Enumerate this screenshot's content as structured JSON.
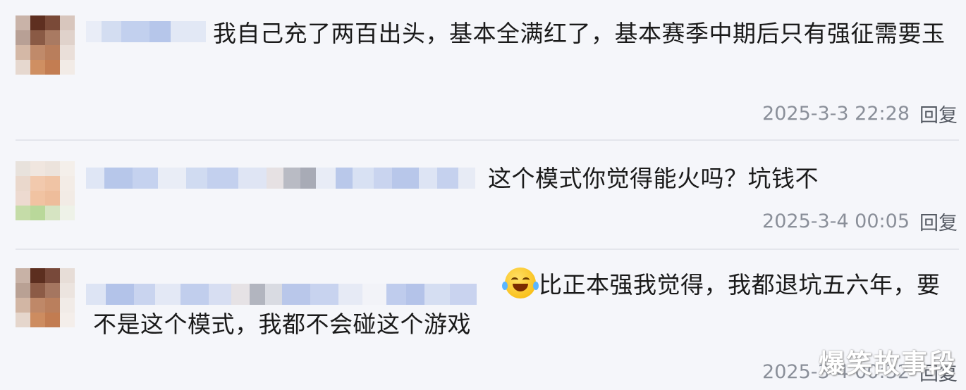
{
  "comments": [
    {
      "text": "我自己充了两百出头，基本全满红了，基本赛季中期后只有强征需要玉",
      "time": "2025-3-3 22:28",
      "reply": "回复"
    },
    {
      "text": "这个模式你觉得能火吗？坑钱不",
      "time": "2025-3-4 00:05",
      "reply": "回复"
    },
    {
      "emoji": "laughing-crying-emoji",
      "text": "比正本强我觉得，我都退坑五六年，要不是这个模式，我都不会碰这个游戏",
      "time": "2025-3-4 00:32",
      "reply": "回复"
    }
  ],
  "watermark": "爆笑故事段",
  "colors": {
    "background": "#f5f6fa",
    "timestamp": "#8a8f99",
    "blur_blue": "#b8c8ea"
  }
}
